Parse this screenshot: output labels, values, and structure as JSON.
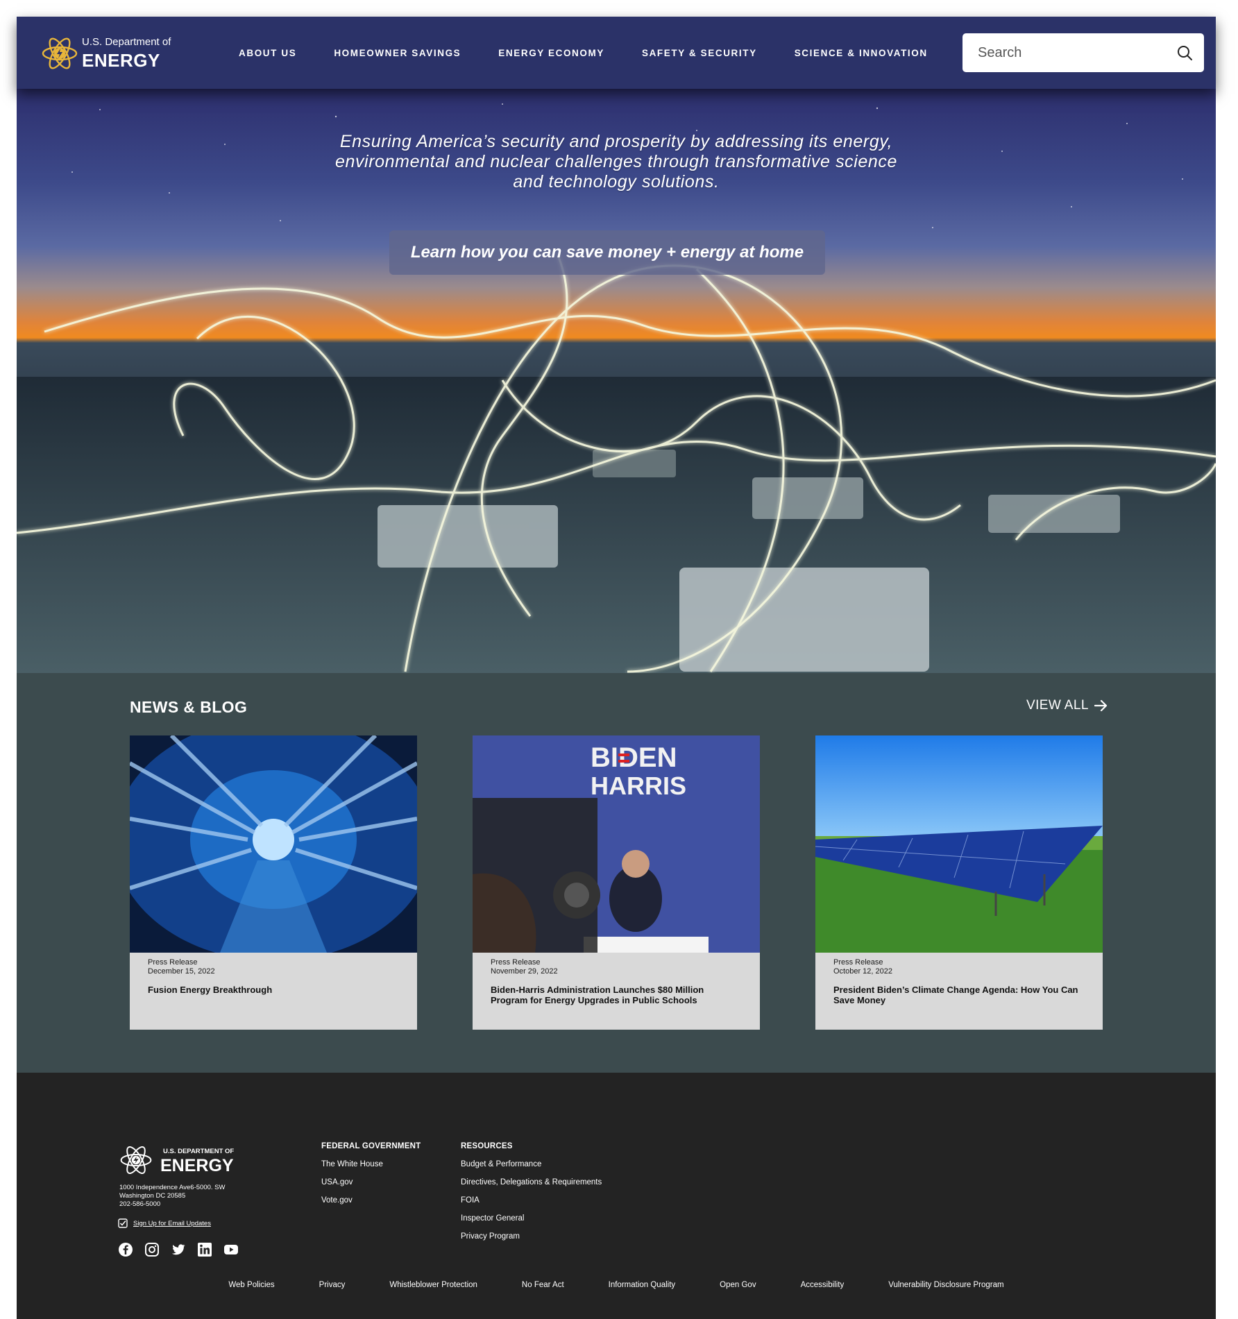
{
  "header": {
    "logo_small": "U.S. Department of",
    "logo_big": "ENERGY",
    "nav": [
      {
        "label": "ABOUT US"
      },
      {
        "label": "HOMEOWNER SAVINGS"
      },
      {
        "label": "ENERGY ECONOMY"
      },
      {
        "label": "SAFETY & SECURITY"
      },
      {
        "label": "SCIENCE & INNOVATION"
      }
    ],
    "search_placeholder": "Search"
  },
  "hero": {
    "tagline_lines": [
      "Ensuring America’s security and prosperity by addressing its energy,",
      "environmental and nuclear challenges through transformative science",
      "and technology solutions."
    ],
    "cta": "Learn how you can save money + energy at home"
  },
  "news": {
    "title": "NEWS & BLOG",
    "view_all": "VIEW ALL",
    "cards": [
      {
        "type": "Press Release",
        "date": "December 15, 2022",
        "headline": "Fusion Energy Breakthrough",
        "image": "fusion-lab-image"
      },
      {
        "type": "Press Release",
        "date": "November 29, 2022",
        "headline": "Biden-Harris Administration Launches $80 Million Program for Energy Upgrades in Public Schools",
        "image": "press-conference-image",
        "image_text": [
          "BIDEN",
          "HARRIS"
        ]
      },
      {
        "type": "Press Release",
        "date": "October 12, 2022",
        "headline": "President Biden’s Climate Change Agenda: How You Can Save Money",
        "image": "solar-panel-image"
      }
    ]
  },
  "footer": {
    "logo_small": "U.S. DEPARTMENT OF",
    "logo_big": "ENERGY",
    "address_lines": [
      "1000 Independence Ave6-5000. SW",
      "Washington DC 20585",
      "202-586-5000"
    ],
    "signup": "Sign Up for Email Updates",
    "social": [
      "facebook-icon",
      "instagram-icon",
      "twitter-icon",
      "linkedin-icon",
      "youtube-icon"
    ],
    "columns": [
      {
        "title": "FEDERAL GOVERNMENT",
        "links": [
          "The White House",
          "USA.gov",
          "Vote.gov"
        ]
      },
      {
        "title": "RESOURCES",
        "links": [
          "Budget & Performance",
          "Directives, Delegations & Requirements",
          "FOIA",
          "Inspector General",
          "Privacy Program"
        ]
      }
    ],
    "bottom_links": [
      "Web Policies",
      "Privacy",
      "Whistleblower Protection",
      "No Fear Act",
      "Information Quality",
      "Open Gov",
      "Accessibility",
      "Vulnerability Disclosure Program"
    ]
  },
  "colors": {
    "header_bg": "#2b3268",
    "news_bg": "#3c4b4e",
    "footer_bg": "#232323",
    "card_bg": "#d9d9d9",
    "logo_gold": "#e8b63a"
  }
}
